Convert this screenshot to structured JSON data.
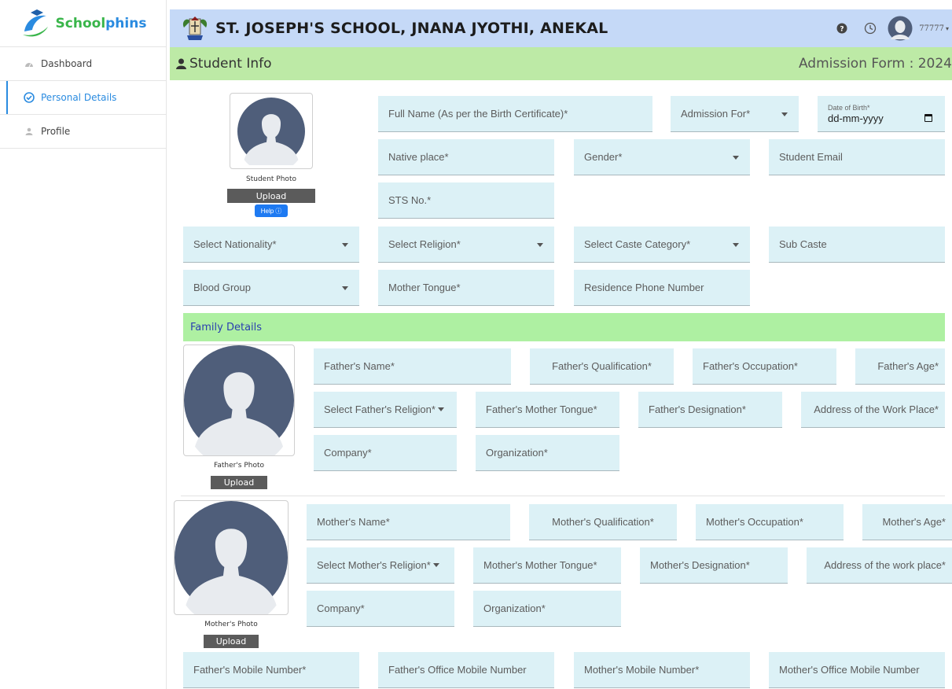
{
  "brand": {
    "name_part1": "School",
    "name_part2": "phins",
    "color1": "#2a8be0",
    "color2": "#39b54a"
  },
  "sidebar": {
    "items": [
      {
        "label": "Dashboard",
        "icon": "dashboard-icon",
        "active": false
      },
      {
        "label": "Personal Details",
        "icon": "check-circle-icon",
        "active": true
      },
      {
        "label": "Profile",
        "icon": "user-icon",
        "active": false
      }
    ]
  },
  "header": {
    "school_name": "ST. JOSEPH'S SCHOOL, JNANA JYOTHI, ANEKAL",
    "user_id": "77777",
    "icons": [
      "help-icon",
      "clock-icon",
      "avatar-icon"
    ]
  },
  "page": {
    "title": "Student Info",
    "form_title": "Admission Form : 2024"
  },
  "student": {
    "photo_label": "Student Photo",
    "upload_label": "Upload",
    "help_label": "Help",
    "full_name": "Full Name (As per the Birth Certificate)*",
    "admission_for": "Admission For*",
    "dob_label": "Date of Birth*",
    "dob_value": "dd-mm-yyyy",
    "native_place": "Native place*",
    "gender": "Gender*",
    "email": "Student Email",
    "sts_no": "STS No.*",
    "nationality": "Select Nationality*",
    "religion": "Select Religion*",
    "caste": "Select Caste Category*",
    "sub_caste": "Sub Caste",
    "blood_group": "Blood Group",
    "mother_tongue": "Mother Tongue*",
    "residence_phone": "Residence Phone Number"
  },
  "family": {
    "section_title": "Family Details",
    "father_photo_label": "Father's Photo",
    "mother_photo_label": "Mother's Photo",
    "upload_label": "Upload",
    "father": {
      "name": "Father's Name*",
      "qualification": "Father's Qualification*",
      "occupation": "Father's Occupation*",
      "age": "Father's Age*",
      "religion": "Select Father's Religion*",
      "mother_tongue": "Father's Mother Tongue*",
      "designation": "Father's Designation*",
      "work_address": "Address of the Work Place*",
      "company": "Company*",
      "organization": "Organization*"
    },
    "mother": {
      "name": "Mother's Name*",
      "qualification": "Mother's Qualification*",
      "occupation": "Mother's Occupation*",
      "age": "Mother's Age*",
      "religion": "Select Mother's Religion*",
      "mother_tongue": "Mother's Mother Tongue*",
      "designation": "Mother's Designation*",
      "work_address": "Address of the work place*",
      "company": "Company*",
      "organization": "Organization*"
    }
  },
  "contacts": {
    "father_mobile": "Father's Mobile Number*",
    "father_office_mobile": "Father's Office Mobile Number",
    "mother_mobile": "Mother's Mobile Number*",
    "mother_office_mobile": "Mother's Office Mobile Number"
  }
}
